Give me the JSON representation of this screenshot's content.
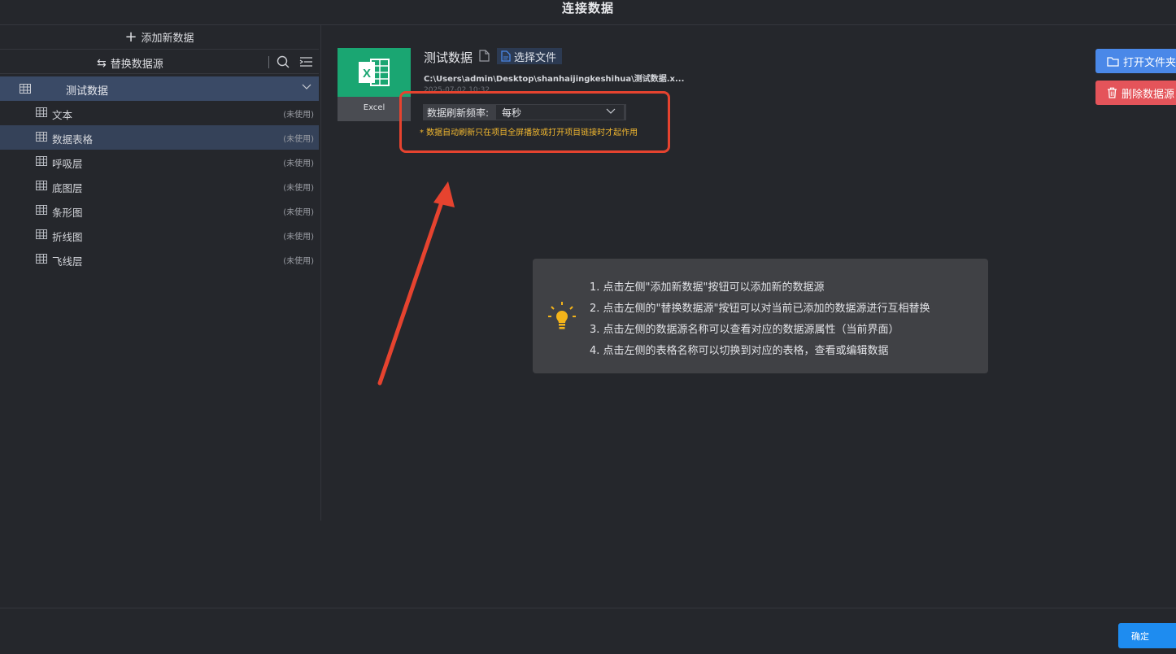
{
  "window": {
    "title": "连接数据"
  },
  "sidebar": {
    "add_label": "添加新数据",
    "replace_label": "替换数据源",
    "source": {
      "name": "测试数据"
    },
    "tables": [
      {
        "name": "文本",
        "status": "(未使用)"
      },
      {
        "name": "数据表格",
        "status": "(未使用)",
        "selected": true
      },
      {
        "name": "呼吸层",
        "status": "(未使用)"
      },
      {
        "name": "底图层",
        "status": "(未使用)"
      },
      {
        "name": "条形图",
        "status": "(未使用)"
      },
      {
        "name": "折线图",
        "status": "(未使用)"
      },
      {
        "name": "飞线层",
        "status": "(未使用)"
      }
    ]
  },
  "detail": {
    "file_type": "Excel",
    "title": "测试数据",
    "choose_file_label": "选择文件",
    "path": "C:\\Users\\admin\\Desktop\\shanhaijingkeshihua\\测试数据.x...",
    "date": "2025-07-02 10:32",
    "refresh_label": "数据刷新频率:",
    "refresh_value": "每秒",
    "notice": "* 数据自动刷新只在项目全屏播放或打开项目链接时才起作用"
  },
  "actions": {
    "open_folder": "打开文件夹",
    "delete_source": "删除数据源"
  },
  "tips": [
    "1. 点击左侧\"添加新数据\"按钮可以添加新的数据源",
    "2. 点击左侧的\"替换数据源\"按钮可以对当前已添加的数据源进行互相替换",
    "3. 点击左侧的数据源名称可以查看对应的数据源属性（当前界面）",
    "4. 点击左侧的表格名称可以切换到对应的表格，查看或编辑数据"
  ],
  "footer": {
    "confirm": "确定"
  },
  "colors": {
    "accent_blue": "#4a88e8",
    "danger_red": "#e4545a",
    "excel_green": "#1aa672",
    "annotation_red": "#e6432f",
    "notice_yellow": "#f2b830"
  }
}
